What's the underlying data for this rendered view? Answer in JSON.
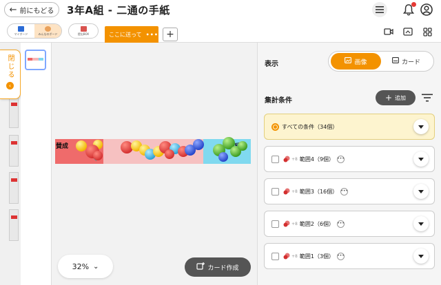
{
  "header": {
    "back_label": "前にもどる",
    "title": "3年A組 - 二通の手紙"
  },
  "toolbar": {
    "my_board_label": "マイボード",
    "all_board_label": "みんなのボード",
    "submit_box_label": "提出BOX",
    "active_tab_label": "ここに送って",
    "active_tab_menu": "•••",
    "add_tab_label": "+"
  },
  "sidebar": {
    "close_label": "閉じる"
  },
  "board": {
    "left_label": "賛成",
    "right_label": "反対"
  },
  "canvas": {
    "zoom": "32%",
    "make_card_label": "カード作成"
  },
  "panel": {
    "view_label": "表示",
    "view_options": [
      "画像",
      "カード"
    ],
    "view_selected": "画像",
    "aggregate_label": "集計条件",
    "add_label": "追加",
    "conditions": [
      {
        "label": "すべての条件（34個）",
        "selected": true
      },
      {
        "label": "範囲4（9個）",
        "selected": false,
        "badge": "+8"
      },
      {
        "label": "範囲3（16個）",
        "selected": false,
        "badge": "+8"
      },
      {
        "label": "範囲2（6個）",
        "selected": false,
        "badge": "+8"
      },
      {
        "label": "範囲1（3個）",
        "selected": false,
        "badge": "+8"
      }
    ]
  },
  "colors": {
    "accent": "#f39200",
    "pin_red": "#e53935",
    "pin_yellow": "#f5c518",
    "pin_blue": "#2f5bd6",
    "pin_green": "#43b02a",
    "pin_cyan": "#3fb7e6"
  }
}
